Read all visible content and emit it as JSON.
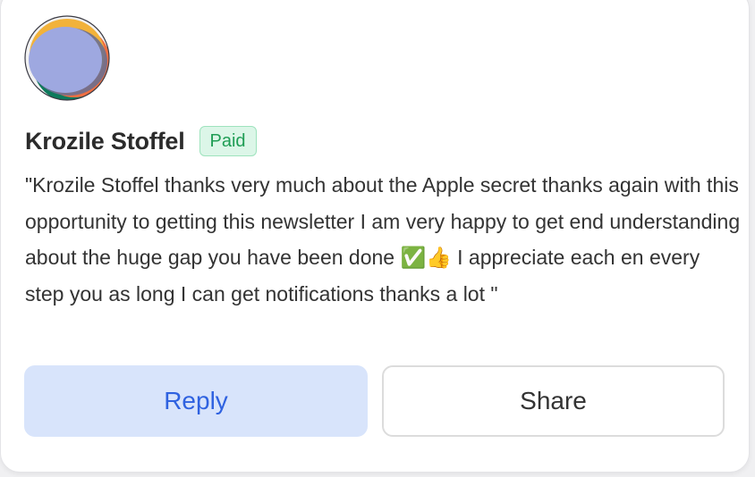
{
  "colors": {
    "accent": "#2f62e0",
    "reply_bg": "#d8e4fb",
    "paid_badge_bg": "#dcf6e8",
    "paid_badge_text": "#1f9d55"
  },
  "author": {
    "name": "Krozile Stoffel",
    "badge": "Paid",
    "avatar_icon": "user-avatar-abstract"
  },
  "comment": {
    "text": "\"Krozile Stoffel thanks very much about the Apple secret thanks again with this opportunity to getting this newsletter I am very happy to get end understanding about the huge gap you have been done ✅👍 I appreciate each en every step you as long I can get notifications thanks a lot \""
  },
  "actions": {
    "reply_label": "Reply",
    "share_label": "Share"
  }
}
